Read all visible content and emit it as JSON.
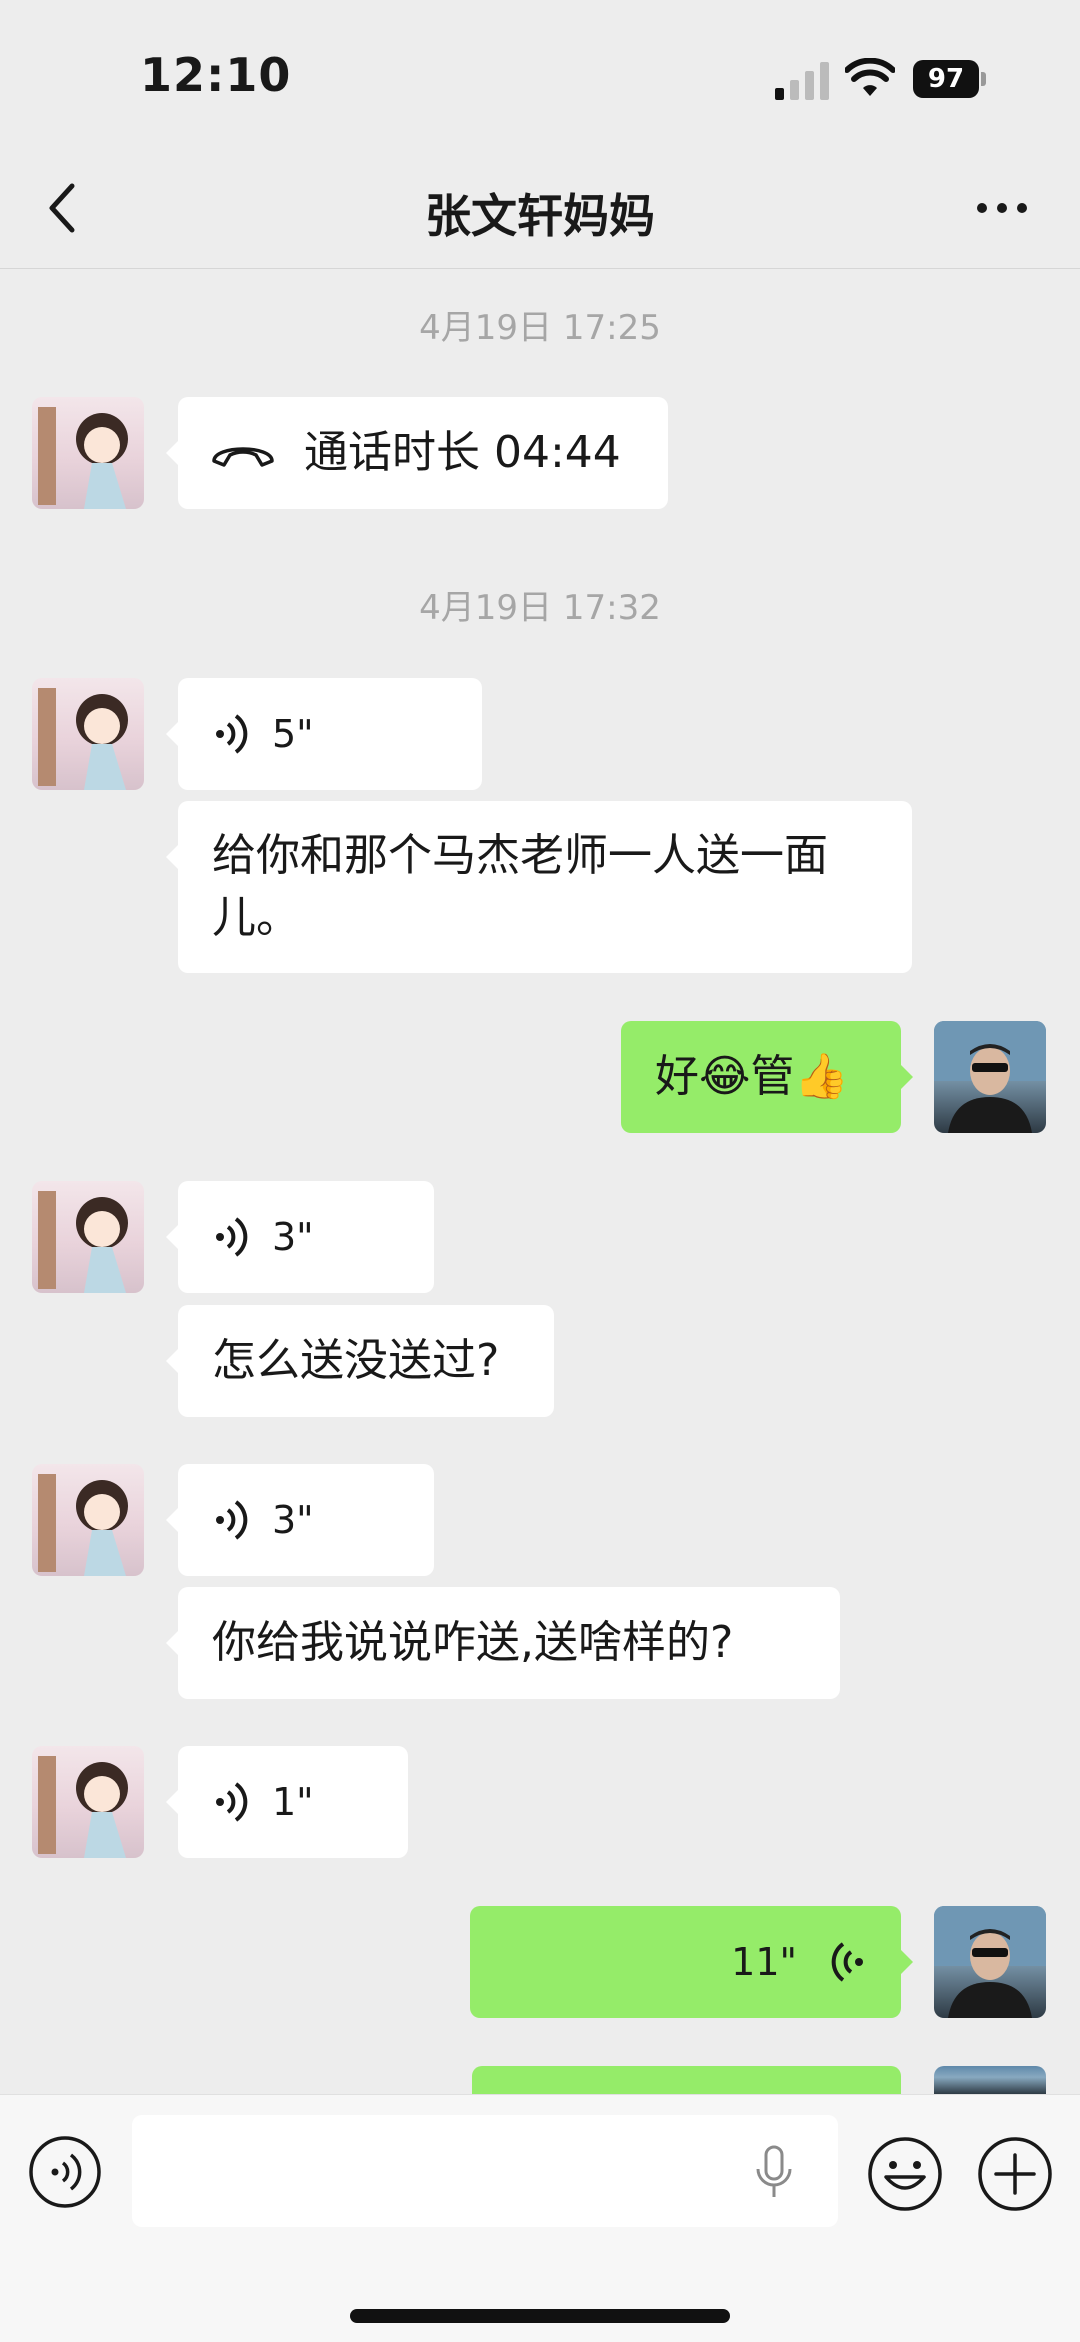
{
  "status_bar": {
    "time": "12:10",
    "battery": "97"
  },
  "nav": {
    "title": "张文轩妈妈"
  },
  "messages": [
    {
      "type": "timestamp",
      "text": "4月19日 17:25"
    },
    {
      "type": "call",
      "side": "left",
      "text": "通话时长 04:44"
    },
    {
      "type": "timestamp",
      "text": "4月19日 17:32"
    },
    {
      "type": "voice",
      "side": "left",
      "duration": "5\""
    },
    {
      "type": "text",
      "side": "left",
      "text": "给你和那个马杰老师一人送一面儿。"
    },
    {
      "type": "text",
      "side": "right",
      "text": "好😂管👍"
    },
    {
      "type": "voice",
      "side": "left",
      "duration": "3\""
    },
    {
      "type": "text",
      "side": "left",
      "text": "怎么送没送过?"
    },
    {
      "type": "voice",
      "side": "left",
      "duration": "3\""
    },
    {
      "type": "text",
      "side": "left",
      "text": "你给我说说咋送,送啥样的?"
    },
    {
      "type": "voice",
      "side": "left",
      "duration": "1\""
    },
    {
      "type": "voice",
      "side": "right",
      "duration": "11\""
    }
  ],
  "icons": {
    "back": "chevron-left-icon",
    "more": "more-icon",
    "voice_input": "voice-mode-icon",
    "mic": "microphone-icon",
    "emoji": "emoji-icon",
    "plus": "plus-icon"
  }
}
